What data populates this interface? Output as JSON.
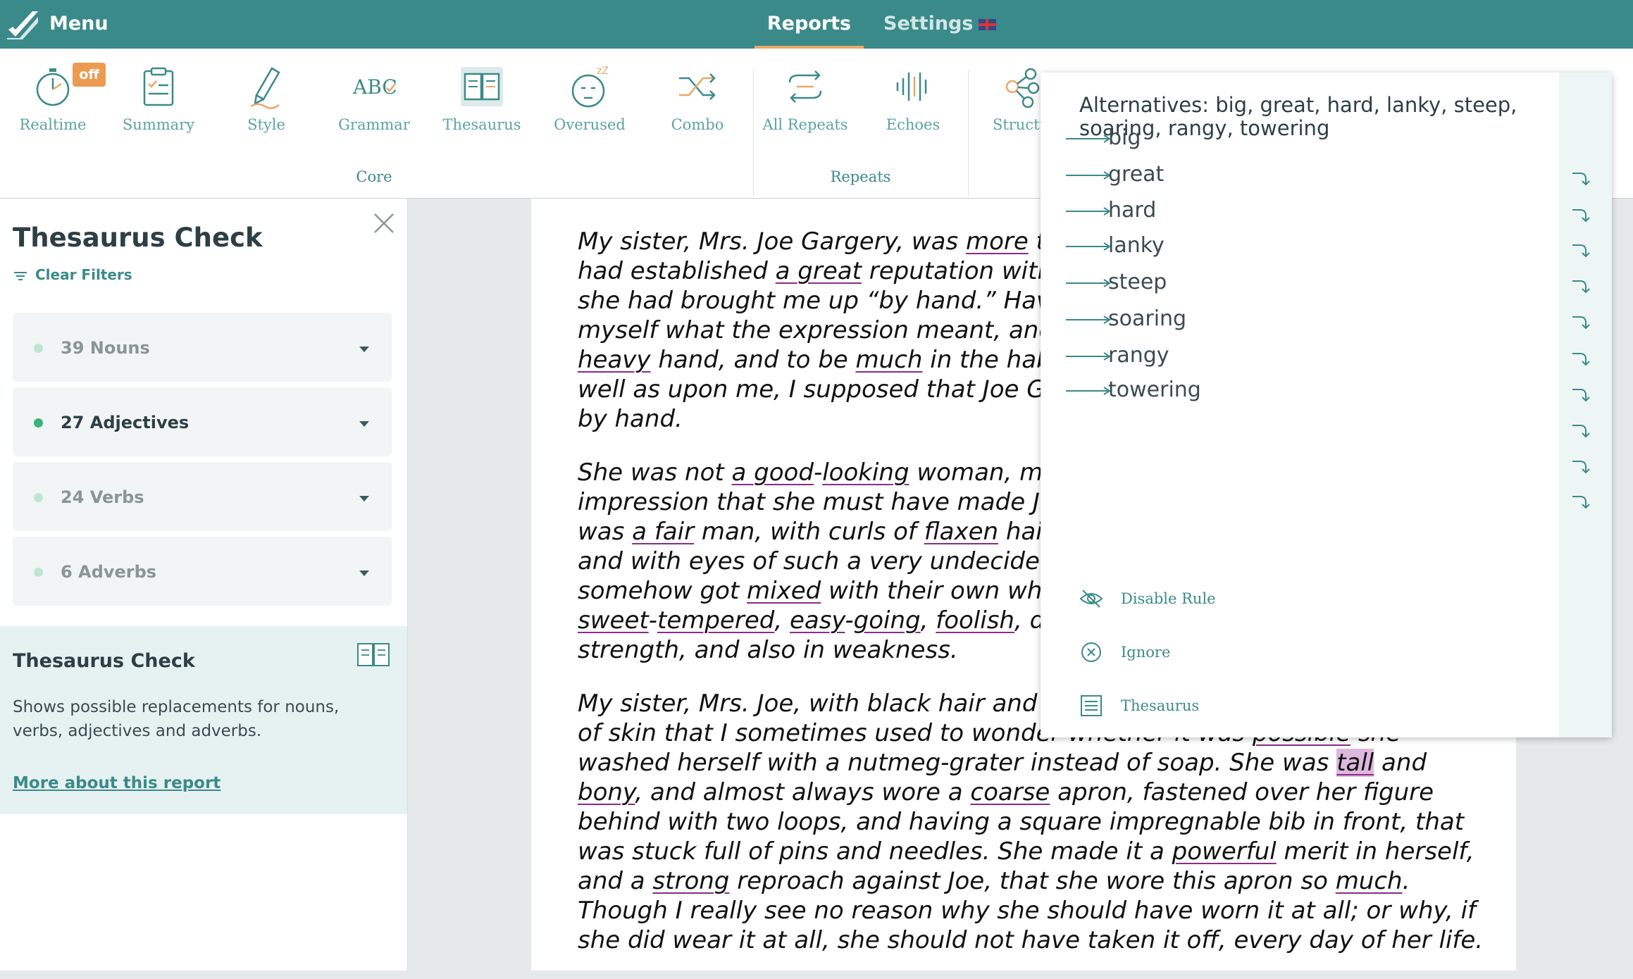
{
  "topbar": {
    "menu_label": "Menu",
    "tabs": [
      {
        "label": "Reports"
      },
      {
        "label": "Settings"
      }
    ]
  },
  "toolbar": {
    "realtime_badge": "off",
    "tools": [
      {
        "label": "Realtime",
        "icon": "stopwatch-icon"
      },
      {
        "label": "Summary",
        "icon": "clipboard-icon"
      },
      {
        "label": "Style",
        "icon": "pencil-icon"
      },
      {
        "label": "Grammar",
        "icon": "abc-check-icon"
      },
      {
        "label": "Thesaurus",
        "icon": "open-book-icon"
      },
      {
        "label": "Overused",
        "icon": "sleepy-face-icon"
      },
      {
        "label": "Combo",
        "icon": "shuffle-icon"
      },
      {
        "label": "All Repeats",
        "icon": "repeat-arrows-icon"
      },
      {
        "label": "Echoes",
        "icon": "sound-wave-icon"
      },
      {
        "label": "Structu",
        "icon": "structure-icon"
      }
    ],
    "groups": [
      {
        "label": "Core"
      },
      {
        "label": "Repeats"
      }
    ]
  },
  "leftpanel": {
    "title": "Thesaurus Check",
    "clear_filters": "Clear Filters",
    "filters": [
      {
        "label": "39 Nouns",
        "active": false
      },
      {
        "label": "27 Adjectives",
        "active": true
      },
      {
        "label": "24 Verbs",
        "active": false
      },
      {
        "label": "6 Adverbs",
        "active": false
      }
    ],
    "info": {
      "title": "Thesaurus Check",
      "description": "Shows possible replacements for nouns, verbs, adjectives and adverbs.",
      "link": "More about this report"
    }
  },
  "document": {
    "p1": [
      {
        "t": "My sister, Mrs. Joe Gargery, was "
      },
      {
        "t": "more",
        "u": true
      },
      {
        "t": " than twenty years older than I, and "
      },
      {
        "t": "had established "
      },
      {
        "t": "a great",
        "u": true
      },
      {
        "t": " reputation with herself and the neighbors because "
      },
      {
        "t": "she had brought me up “by hand.” Having at that time to find out for "
      },
      {
        "t": "myself what the expression meant, and knowing her to have a hard and "
      },
      {
        "t": "heavy",
        "u": true
      },
      {
        "t": " hand, and to be "
      },
      {
        "t": "much",
        "u": true
      },
      {
        "t": " in the habit of laying it upon her husband as "
      },
      {
        "t": "well as upon me, I supposed that Joe Gargery and I were both brought up "
      },
      {
        "t": "by hand."
      }
    ],
    "p2": [
      {
        "t": "She was not "
      },
      {
        "t": "a good",
        "u": true
      },
      {
        "t": "-"
      },
      {
        "t": "looking",
        "u": true
      },
      {
        "t": " woman, my sister; and I had a general "
      },
      {
        "t": "impression that she must have made Joe Gargery marry her by hand. Joe "
      },
      {
        "t": "was "
      },
      {
        "t": "a fair",
        "u": true
      },
      {
        "t": " man, with curls of "
      },
      {
        "t": "flaxen",
        "u": true
      },
      {
        "t": " hair on each side of his smooth face, "
      },
      {
        "t": "and with eyes of such a very undecided blue that they seemed to have "
      },
      {
        "t": "somehow got "
      },
      {
        "t": "mixed",
        "u": true
      },
      {
        "t": " with their own whites. He was a mild, good-natured, "
      },
      {
        "t": "sweet",
        "u": true
      },
      {
        "t": "-"
      },
      {
        "t": "tempered",
        "u": true
      },
      {
        "t": ", "
      },
      {
        "t": "easy",
        "u": true
      },
      {
        "t": "-"
      },
      {
        "t": "going",
        "u": true
      },
      {
        "t": ", "
      },
      {
        "t": "foolish",
        "u": true
      },
      {
        "t": ", dear fellow,—a sort of Hercules in "
      },
      {
        "t": "strength, and also in weakness."
      }
    ],
    "p3": [
      {
        "t": "My sister, Mrs. Joe, with black hair and eyes, had such a prevailing redness "
      },
      {
        "t": "of skin that I sometimes used to wonder whether it was "
      },
      {
        "t": "possible",
        "u": true
      },
      {
        "t": " she "
      },
      {
        "t": "washed herself with a nutmeg-grater instead of soap. She was "
      },
      {
        "t": "tall",
        "u": true,
        "h": true
      },
      {
        "t": " and "
      },
      {
        "t": "bony",
        "u": true
      },
      {
        "t": ", and almost always wore a "
      },
      {
        "t": "coarse",
        "u": true
      },
      {
        "t": " apron, fastened over her figure "
      },
      {
        "t": "behind with two loops, and having a square impregnable bib in front, that "
      },
      {
        "t": "was stuck full of pins and needles. She made it a "
      },
      {
        "t": "powerful",
        "u": true
      },
      {
        "t": " merit in herself, "
      },
      {
        "t": "and a "
      },
      {
        "t": "strong",
        "u": true
      },
      {
        "t": " reproach against Joe, that she wore this apron so "
      },
      {
        "t": "much",
        "u": true
      },
      {
        "t": ". "
      },
      {
        "t": "Though I really see no reason why she should have worn it at all; or why, if "
      },
      {
        "t": "she did wear it at all, she should not have taken it off, every day of her life."
      }
    ]
  },
  "popup": {
    "title": "Alternatives: big, great, hard, lanky, steep, soaring, rangy, towering",
    "alternatives": [
      "big",
      "great",
      "hard",
      "lanky",
      "steep",
      "soaring",
      "rangy",
      "towering"
    ],
    "actions": [
      {
        "label": "Disable Rule",
        "icon": "eye-off-icon"
      },
      {
        "label": "Ignore",
        "icon": "x-circle-icon"
      },
      {
        "label": "Thesaurus",
        "icon": "list-doc-icon"
      }
    ]
  }
}
